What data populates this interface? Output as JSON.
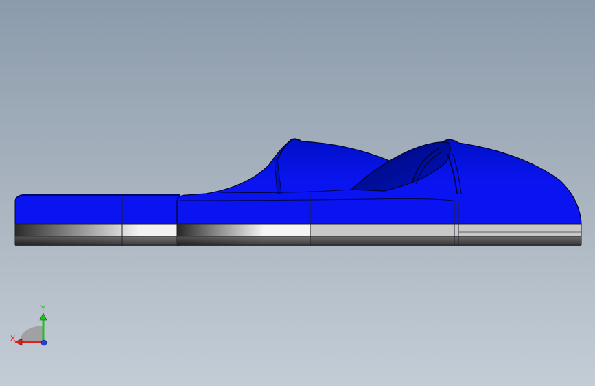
{
  "viewport": {
    "background_top": "#8b9bac",
    "background_bottom": "#c4cdd6"
  },
  "model": {
    "description_icon": "3d-slipper-shoe-model",
    "upper_color": "#0a14f0",
    "sole_color": "#c8c8c8",
    "outline_color": "#0a0a2a"
  },
  "triad": {
    "x_label": "X",
    "y_label": "Y",
    "x_color": "#e02020",
    "y_color": "#20c020",
    "z_color": "#2040e0"
  }
}
